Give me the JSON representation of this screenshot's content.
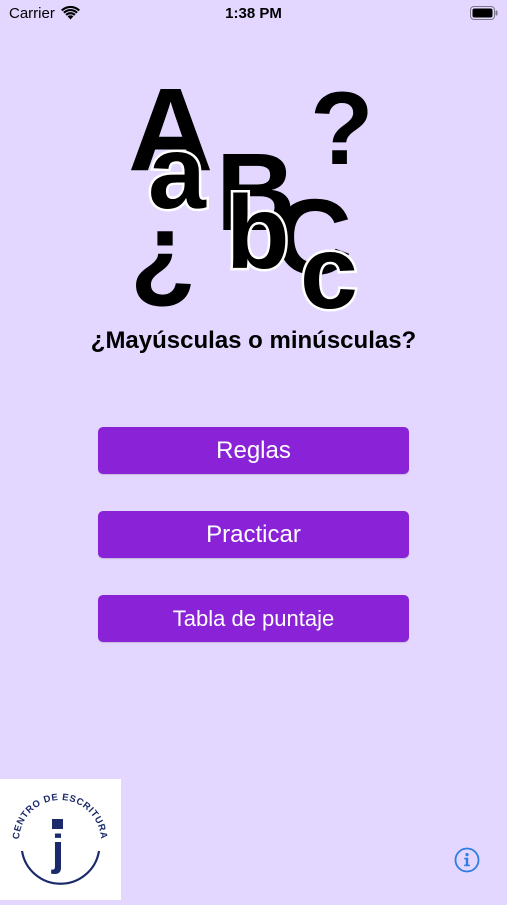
{
  "status_bar": {
    "carrier": "Carrier",
    "time": "1:38 PM"
  },
  "logo": {
    "letters": [
      "A",
      "B",
      "?",
      "C",
      "a",
      "b",
      "c",
      "¿"
    ]
  },
  "page_title": "¿Mayúsculas o minúsculas?",
  "buttons": {
    "rules": "Reglas",
    "practice": "Practicar",
    "scoreboard": "Tabla de puntaje"
  },
  "brand": {
    "text": "CENTRO DE ESCRITURA",
    "mark": "j"
  },
  "colors": {
    "background": "#e3d7ff",
    "button": "#8a22d8",
    "info_icon": "#2f7de1"
  },
  "icons": {
    "info": "info-circle-icon"
  }
}
